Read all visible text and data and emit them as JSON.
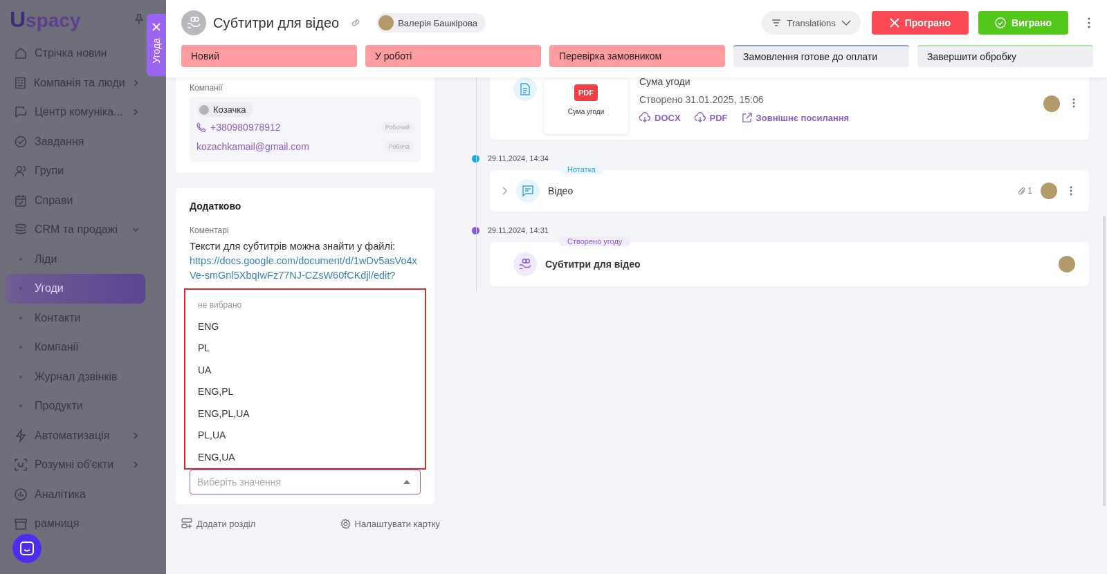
{
  "sidebar": {
    "logo_mark": "U",
    "logo_text": "spacy",
    "items": [
      {
        "label": "Стрічка новин"
      },
      {
        "label": "Компанія та люди",
        "expanded": false
      },
      {
        "label": "Центр комуніка...",
        "expanded": false
      },
      {
        "label": "Завдання"
      },
      {
        "label": "Групи"
      },
      {
        "label": "Справи"
      },
      {
        "label": "CRM та продажі",
        "expanded": true,
        "children": [
          {
            "label": "Ліди",
            "selected": false
          },
          {
            "label": "Угоди",
            "selected": true
          },
          {
            "label": "Контакти",
            "selected": false
          },
          {
            "label": "Компанії",
            "selected": false
          },
          {
            "label": "Журнал дзвінків",
            "selected": false
          },
          {
            "label": "Продукти",
            "selected": false
          }
        ]
      },
      {
        "label": "Автоматизація",
        "expanded": false
      },
      {
        "label": "Розумні об'єкти",
        "expanded": false
      },
      {
        "label": "Аналітика"
      },
      {
        "label": "рамниця"
      }
    ]
  },
  "side_tab": {
    "label": "Угода"
  },
  "header": {
    "title": "Субтитри для відео",
    "owner": "Валерія Башкірова",
    "filter": "Translations",
    "lost_button": "Програно",
    "won_button": "Виграно"
  },
  "stages": [
    {
      "label": "Новий",
      "passed": true,
      "color": "#ff9c9f"
    },
    {
      "label": "У роботі",
      "passed": true,
      "color": "#ff9c9f"
    },
    {
      "label": "Перевірка замовником",
      "passed": true,
      "color": "#ff9c9f"
    },
    {
      "label": "Замовлення готове до оплати",
      "passed": false,
      "color": "#86a3cf"
    },
    {
      "label": "Завершити обробку",
      "passed": false,
      "color": "#a3e4a0"
    }
  ],
  "companies": {
    "label": "Компанії",
    "name": "Козачка",
    "phone": "+380980978912",
    "phone_tag": "Робочий",
    "email": "kozachkamail@gmail.com",
    "email_tag": "Робоча"
  },
  "extra": {
    "title": "Додатково",
    "comment_label": "Коментарі",
    "comment": "Тексти для субтитрів можна знайти у файлі:",
    "link": "https://docs.google.com/document/d/1wDv5asVo4xVe-smGnl5XbqIwFz77NJ-CZsW60fCKdjl/edit?",
    "dropdown": {
      "open": true,
      "highlighted": true,
      "placeholder": "Виберіть значення",
      "options": [
        {
          "label": "не вибрано",
          "kind": "none"
        },
        {
          "label": "ENG",
          "kind": "value"
        },
        {
          "label": "PL",
          "kind": "value"
        },
        {
          "label": "UA",
          "kind": "value"
        },
        {
          "label": "ENG,PL",
          "kind": "value"
        },
        {
          "label": "ENG,PL,UA",
          "kind": "value"
        },
        {
          "label": "PL,UA",
          "kind": "value"
        },
        {
          "label": "ENG,UA",
          "kind": "value"
        }
      ]
    }
  },
  "footer_actions": [
    "Додати розділ",
    "Налаштувати картку"
  ],
  "timeline": [
    {
      "kind": "document",
      "thumb_badge": "PDF",
      "thumb_caption": "Сума угоди",
      "title": "Сума угоди",
      "created": "Створено 31.01.2025, 15:06",
      "actions": [
        {
          "label": "DOCX",
          "kind": "download"
        },
        {
          "label": "PDF",
          "kind": "download"
        },
        {
          "label": "Зовнішнє посилання",
          "kind": "link"
        }
      ]
    },
    {
      "kind": "note",
      "date": "29.11.2024, 14:34",
      "color": "#1ea7e8",
      "tag": "Нотатка",
      "title": "Відео",
      "attachments": "1",
      "expanded": false
    },
    {
      "kind": "created",
      "date": "29.11.2024, 14:31",
      "color": "#8b55e6",
      "tag": "Створено угоду",
      "title": "Субтитри для відео"
    }
  ]
}
